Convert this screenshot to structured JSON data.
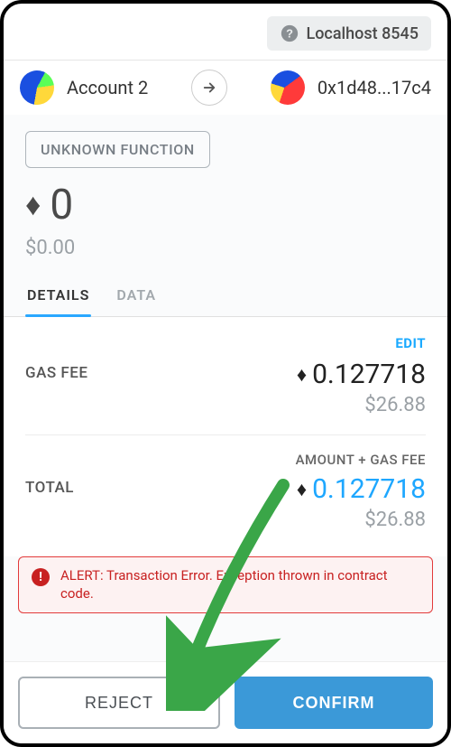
{
  "network": {
    "label": "Localhost 8545"
  },
  "accounts": {
    "from": {
      "label": "Account 2"
    },
    "to": {
      "label": "0x1d48...17c4"
    }
  },
  "function_chip": "UNKNOWN FUNCTION",
  "amount": {
    "eth": "0",
    "usd": "$0.00"
  },
  "tabs": {
    "details": "DETAILS",
    "data": "DATA"
  },
  "edit_label": "EDIT",
  "gas": {
    "label": "GAS FEE",
    "eth": "0.127718",
    "usd": "$26.88"
  },
  "total": {
    "label": "TOTAL",
    "subhead": "AMOUNT + GAS FEE",
    "eth": "0.127718",
    "usd": "$26.88"
  },
  "alert": {
    "text": "ALERT: Transaction Error. Exception thrown in contract code."
  },
  "buttons": {
    "reject": "REJECT",
    "confirm": "CONFIRM"
  }
}
